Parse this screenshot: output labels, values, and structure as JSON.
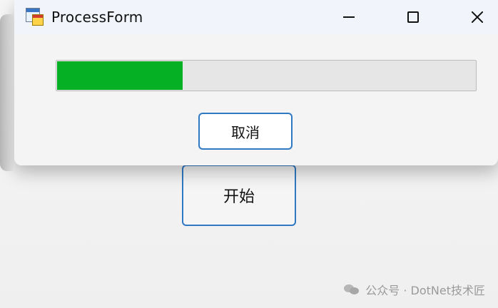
{
  "background_window": {
    "start_button_label": "开始"
  },
  "dialog": {
    "title": "ProcessForm",
    "controls": {
      "minimize_icon": "minimize-icon",
      "maximize_icon": "maximize-icon",
      "close_icon": "close-icon"
    },
    "progress": {
      "value": 0.3,
      "fill_color": "#06b025"
    },
    "cancel_button_label": "取消"
  },
  "watermark": {
    "text": "公众号 · DotNet技术匠"
  }
}
